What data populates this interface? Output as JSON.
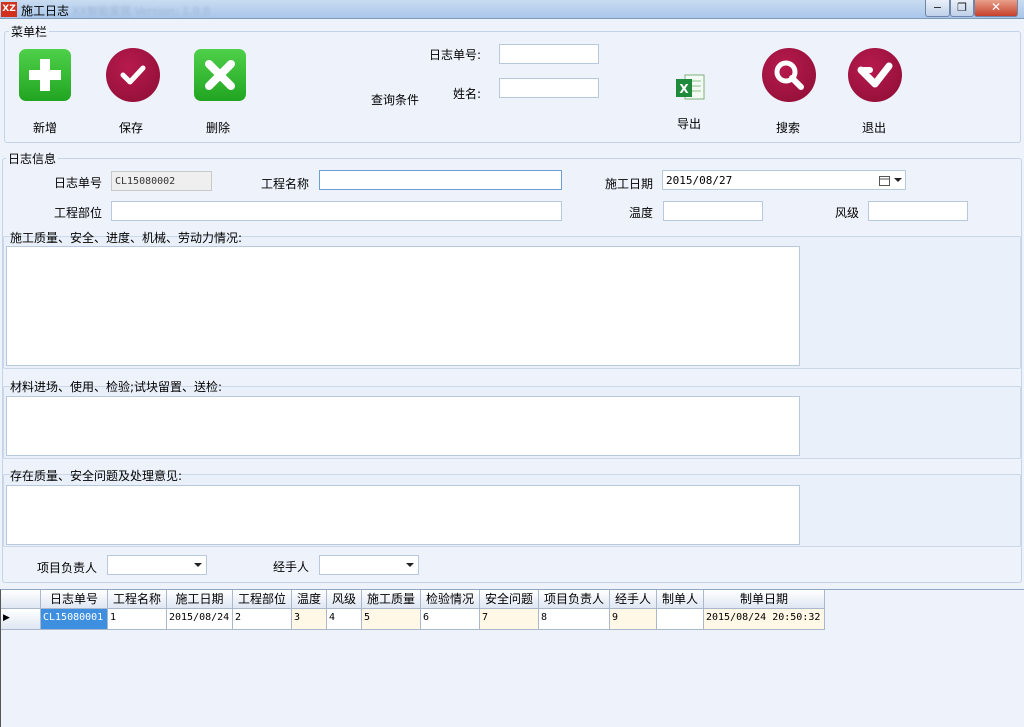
{
  "window": {
    "title": "施工日志",
    "title_suffix": "XX智能家居 Version: 1.0.0",
    "icon_text": "XZ",
    "minimize": "−",
    "restore": "❐",
    "close": "✕"
  },
  "toolbar": {
    "group_label": "菜单栏",
    "buttons": {
      "add": "新增",
      "save": "保存",
      "delete": "删除",
      "export": "导出",
      "search": "搜索",
      "exit": "退出"
    },
    "query_label": "查询条件",
    "log_no_label": "日志单号:",
    "name_label": "姓名:",
    "log_no_value": "",
    "name_value": ""
  },
  "log_info": {
    "group_label": "日志信息",
    "log_no_label": "日志单号",
    "log_no_value": "CL15080002",
    "project_name_label": "工程名称",
    "project_name_value": "",
    "date_label": "施工日期",
    "date_value": "2015/08/27",
    "project_part_label": "工程部位",
    "project_part_value": "",
    "temperature_label": "温度",
    "temperature_value": "",
    "wind_label": "风级",
    "wind_value": "",
    "quality_label": "施工质量、安全、进度、机械、劳动力情况:",
    "material_label": "材料进场、使用、检验;试块留置、送检:",
    "issues_label": "存在质量、安全问题及处理意见:",
    "manager_label": "项目负责人",
    "manager_value": "",
    "handler_label": "经手人",
    "handler_value": ""
  },
  "grid": {
    "columns": [
      "日志单号",
      "工程名称",
      "施工日期",
      "工程部位",
      "温度",
      "风级",
      "施工质量",
      "检验情况",
      "安全问题",
      "项目负责人",
      "经手人",
      "制单人",
      "制单日期"
    ],
    "rows": [
      [
        "CL15080001",
        "1",
        "2015/08/24",
        "2",
        "3",
        "4",
        "5",
        "6",
        "7",
        "8",
        "9",
        "",
        "2015/08/24 20:50:32"
      ]
    ],
    "row_indicator": "▶"
  },
  "colors": {
    "accent_green": "#21a521",
    "accent_red": "#8c0e34",
    "selection": "#3f8fe0"
  }
}
